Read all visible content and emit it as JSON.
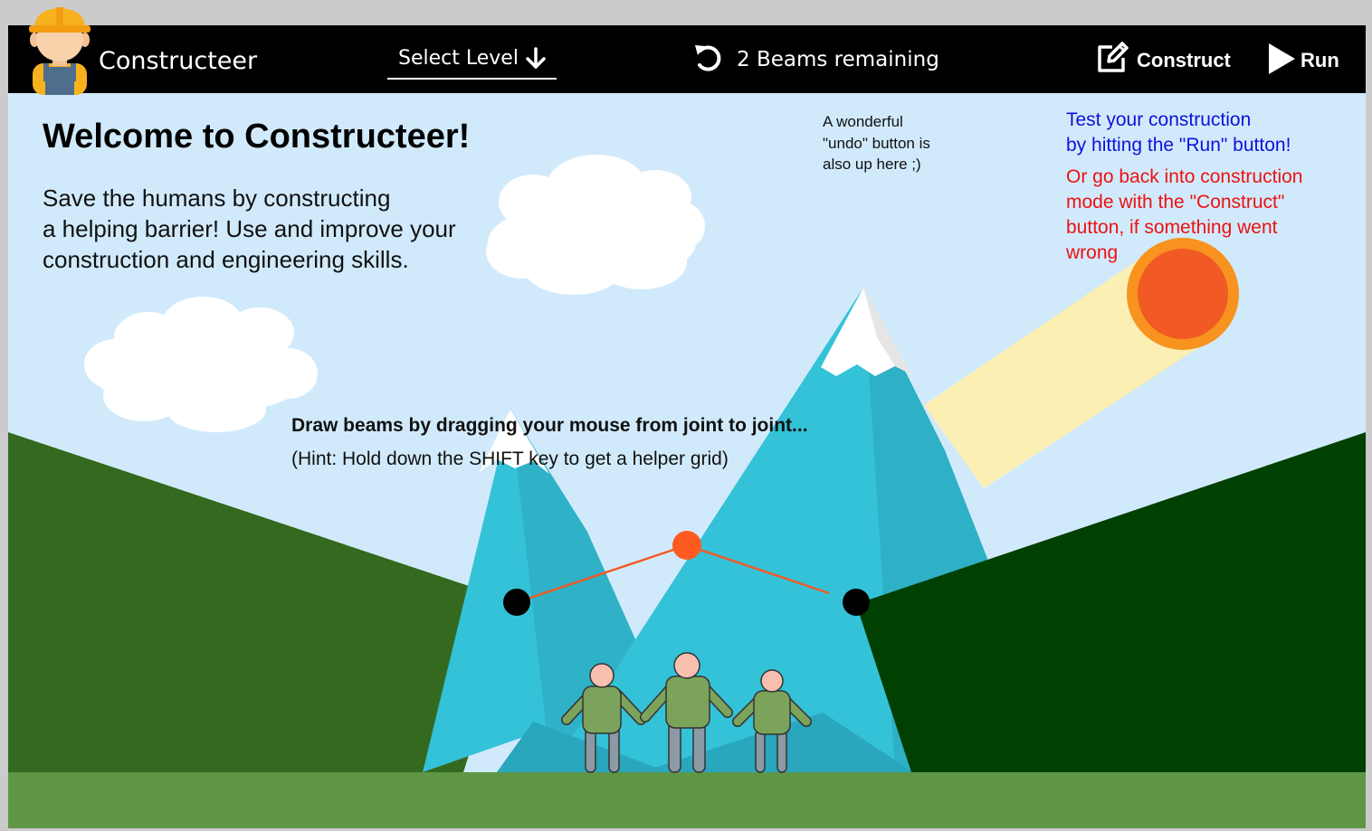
{
  "header": {
    "app_title": "Constructeer",
    "select_level_label": "Select Level",
    "beams_remaining": "2 Beams remaining",
    "construct_label": "Construct",
    "run_label": "Run"
  },
  "intro": {
    "title": "Welcome to Constructeer!",
    "lines": [
      "Save the humans by constructing",
      "a helping barrier! Use and improve your",
      "construction and engineering skills."
    ]
  },
  "notes": {
    "undo": [
      "A wonderful",
      "\"undo\" button is",
      "also up here ;)"
    ],
    "run": [
      "Test your construction",
      "by hitting the \"Run\" button!"
    ],
    "construct": [
      "Or go back into construction",
      "mode with the \"Construct\"",
      "button, if something went",
      "wrong"
    ]
  },
  "hints": {
    "draw": "Draw beams by dragging your mouse from joint to joint...",
    "shift": "(Hint: Hold down the SHIFT key to get a helper grid)"
  },
  "colors": {
    "topbar": "#000000",
    "sky": "#d1eafb",
    "left_hill": "#336a1f",
    "right_hill": "#004000",
    "ground": "#5f9645",
    "mountain": "#33c2d8",
    "beam": "#f05a28",
    "joint": "#000000",
    "active_joint": "#ff5a1f",
    "sun": "#f15a24",
    "sun_ring": "#f7931e",
    "run_note": "#1010dd",
    "construct_note": "#ee1111"
  },
  "icons": [
    "worker-avatar-icon",
    "arrow-down-icon",
    "undo-icon",
    "edit-icon",
    "play-icon"
  ]
}
